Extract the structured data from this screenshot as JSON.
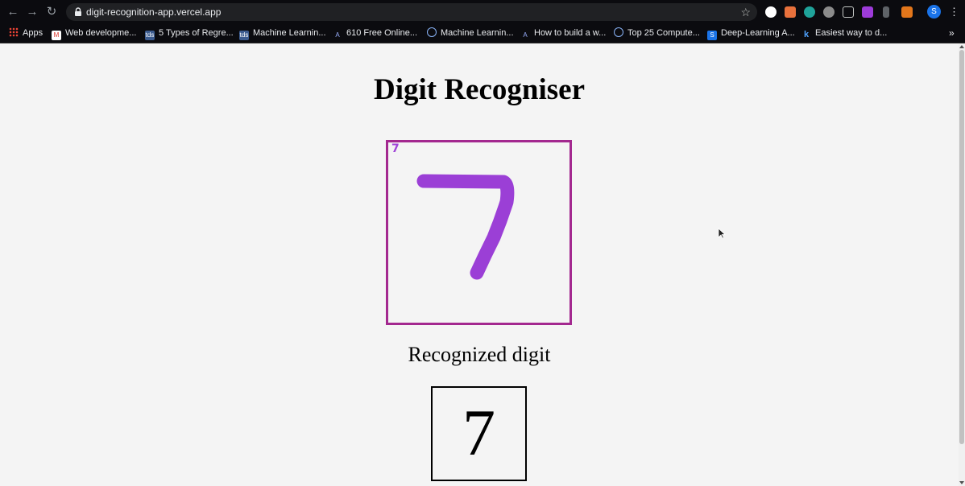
{
  "browser": {
    "url": "digit-recognition-app.vercel.app",
    "profile_initial": "S",
    "bookmarks": [
      {
        "label": "Apps",
        "icon": "apps-grid-icon"
      },
      {
        "label": "Web developme...",
        "icon": "gmail-icon"
      },
      {
        "label": "5 Types of Regre...",
        "icon": "bookmark-icon"
      },
      {
        "label": "Machine Learnin...",
        "icon": "bookmark-icon"
      },
      {
        "label": "610 Free Online...",
        "icon": "bookmark-icon"
      },
      {
        "label": "Machine Learnin...",
        "icon": "bookmark-icon"
      },
      {
        "label": "How to build a w...",
        "icon": "bookmark-icon"
      },
      {
        "label": "Top 25 Compute...",
        "icon": "bookmark-icon"
      },
      {
        "label": "Deep-Learning A...",
        "icon": "bookmark-icon"
      },
      {
        "label": "Easiest way to d...",
        "icon": "bookmark-icon"
      }
    ],
    "more_bookmarks": "»"
  },
  "app": {
    "title": "Digit Recogniser",
    "canvas_label": "7",
    "result_label": "Recognized digit",
    "result_value": "7"
  },
  "colors": {
    "canvas_border": "#a3288f",
    "stroke": "#9b3fd6"
  }
}
